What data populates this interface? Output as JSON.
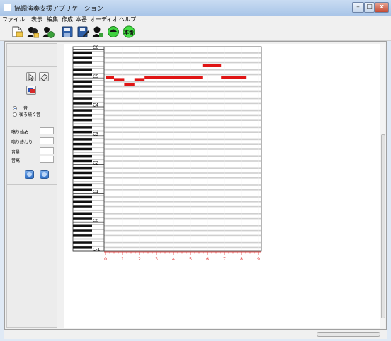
{
  "window": {
    "title": "協調演奏支援アプリケーション"
  },
  "menu": [
    {
      "label": "ファイル"
    },
    {
      "label": "表示"
    },
    {
      "label": "編集"
    },
    {
      "label": "作成"
    },
    {
      "label": "本番"
    },
    {
      "label": "オーディオ"
    },
    {
      "label": "ヘルプ"
    }
  ],
  "toolbar": {
    "buttons": [
      {
        "name": "new-file-icon"
      },
      {
        "name": "open-people-icon"
      },
      {
        "name": "open-add-icon"
      },
      {
        "name": "save-icon"
      },
      {
        "name": "save-as-icon"
      },
      {
        "name": "import-icon"
      },
      {
        "name": "export-icon"
      },
      {
        "name": "live-mode-icon",
        "label": "本番"
      }
    ]
  },
  "sidebar": {
    "tools": [
      {
        "name": "select-icon"
      },
      {
        "name": "eraser-icon"
      },
      {
        "name": "color-icon"
      }
    ],
    "radios": [
      {
        "label": "一音",
        "checked": true
      },
      {
        "label": "後ろ続く音",
        "checked": false
      }
    ],
    "fields": [
      {
        "label": "鳴り始め",
        "value": ""
      },
      {
        "label": "鳴り終わり",
        "value": ""
      },
      {
        "label": "音量",
        "value": ""
      },
      {
        "label": "音高",
        "value": ""
      }
    ],
    "playback": [
      {
        "name": "play-icon"
      },
      {
        "name": "stop-icon"
      }
    ]
  },
  "piano_roll": {
    "octave_labels": [
      "C6",
      "C5",
      "C4",
      "C3",
      "C2",
      "C1",
      "C0",
      "C-1"
    ],
    "x_axis_labels": [
      "0",
      "1",
      "2",
      "3",
      "4",
      "5",
      "6",
      "7",
      "8",
      "9"
    ],
    "notes": [
      {
        "pitch": "C5",
        "start": 0,
        "end": 0.5
      },
      {
        "pitch": "B4",
        "start": 0.5,
        "end": 1.1
      },
      {
        "pitch": "A4",
        "start": 1.1,
        "end": 1.7
      },
      {
        "pitch": "B4",
        "start": 1.7,
        "end": 2.3
      },
      {
        "pitch": "C5",
        "start": 2.3,
        "end": 5.7
      },
      {
        "pitch": "F5",
        "start": 5.7,
        "end": 6.8
      },
      {
        "pitch": "C5",
        "start": 6.8,
        "end": 8.3
      }
    ]
  },
  "colors": {
    "note": "#e01515",
    "axis": "#e02020"
  }
}
